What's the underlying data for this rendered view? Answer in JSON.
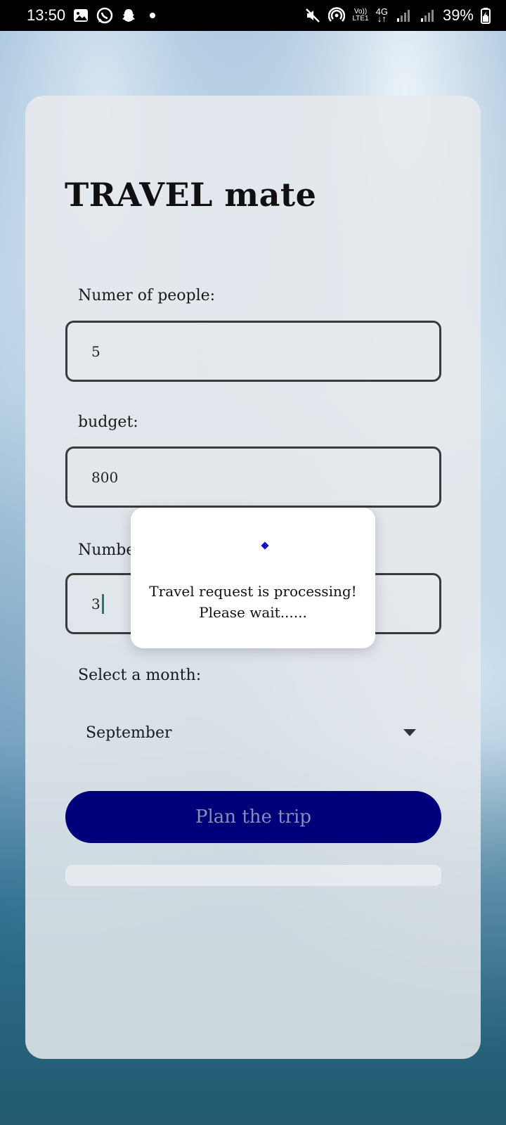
{
  "status_bar": {
    "time": "13:50",
    "network_line1": "Vo))",
    "network_line2": "LTE1",
    "network_type": "4G",
    "battery": "39%",
    "icons": [
      "gallery-icon",
      "whatsapp-icon",
      "snapchat-icon",
      "mute-icon",
      "hotspot-icon",
      "signal-icon",
      "battery-icon"
    ]
  },
  "app": {
    "title": "TRAVEL mate"
  },
  "form": {
    "people_label": "Numer of people:",
    "people_value": "5",
    "budget_label": "budget:",
    "budget_value": "800",
    "days_label": "Number",
    "days_value": "3",
    "month_label": "Select a month:",
    "month_selected": "September",
    "submit_label": "Plan the trip"
  },
  "dialog": {
    "message_line1": "Travel request is processing!",
    "message_line2": "Please wait......",
    "spinner_color": "#1212c8"
  },
  "colors": {
    "button_bg": "#00007a",
    "caret": "#1f7a6a"
  }
}
